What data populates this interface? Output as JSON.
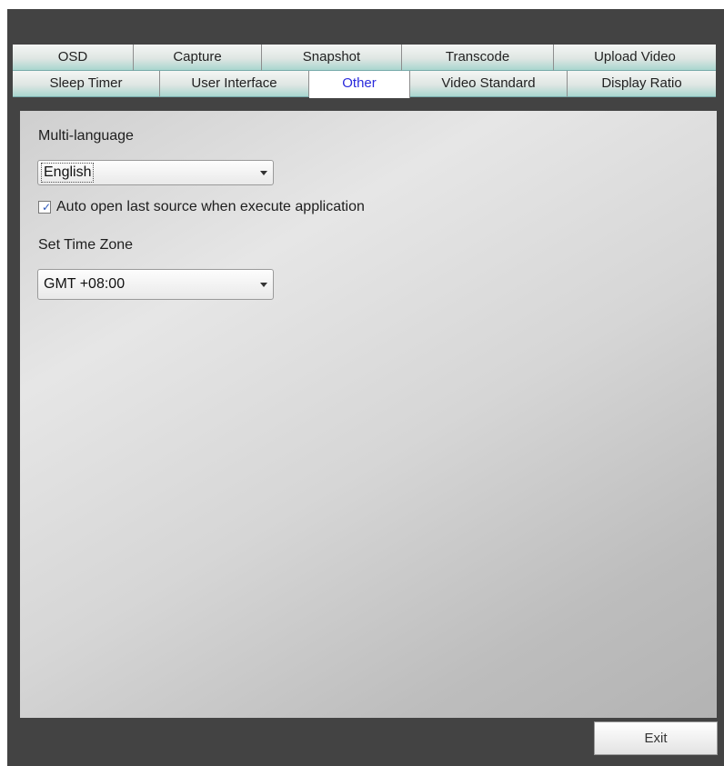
{
  "tabs_top": [
    "OSD",
    "Capture",
    "Snapshot",
    "Transcode",
    "Upload Video"
  ],
  "tabs_bottom": [
    "Sleep Timer",
    "User Interface",
    "Other",
    "Video Standard",
    "Display Ratio"
  ],
  "active_tab": "Other",
  "multi_language": {
    "label": "Multi-language",
    "selected": "English"
  },
  "auto_open": {
    "label": "Auto open last source when execute application",
    "checked": true
  },
  "time_zone": {
    "label": "Set Time Zone",
    "selected": "GMT +08:00"
  },
  "exit_label": "Exit",
  "colors": {
    "background": "#434343",
    "active_tab_text": "#2a2adc",
    "tab_bottom_tint": "#a9d6cf"
  }
}
